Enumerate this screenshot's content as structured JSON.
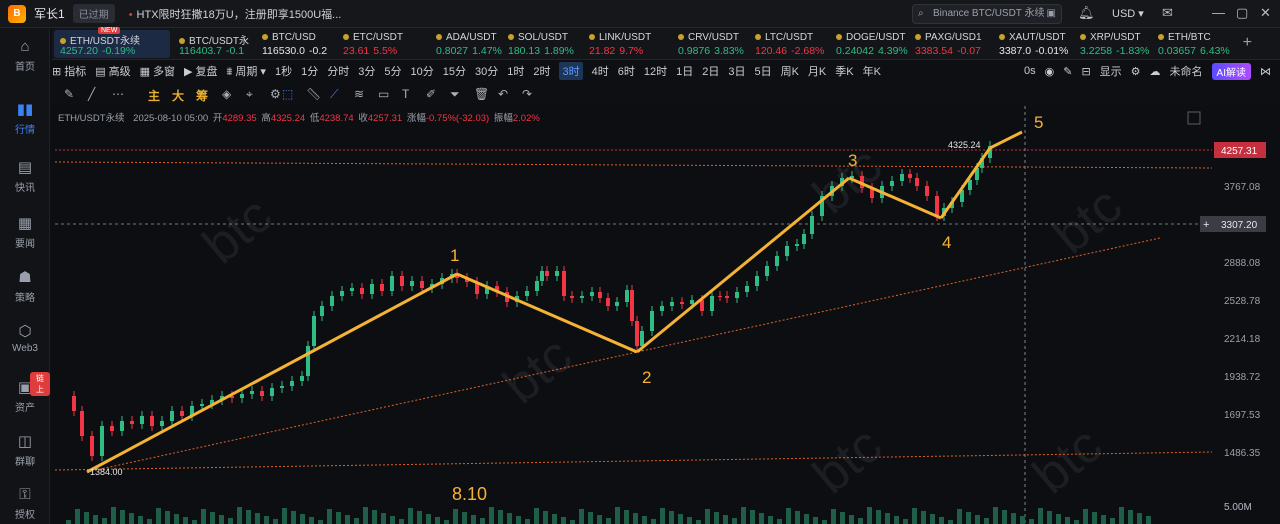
{
  "titlebar": {
    "username": "军长1",
    "status": "已过期",
    "promo": "HTX限时狂撒18万U，注册即享1500U福...",
    "search_placeholder": "Binance BTC/USDT 永续",
    "currency": "USD"
  },
  "sidebar": {
    "items": [
      {
        "label": "首页",
        "icon": "home-icon"
      },
      {
        "label": "行情",
        "icon": "chart-bars-icon"
      },
      {
        "label": "快讯",
        "icon": "news-icon"
      },
      {
        "label": "要闻",
        "icon": "document-icon"
      },
      {
        "label": "策略",
        "icon": "strategy-icon"
      },
      {
        "label": "Web3",
        "icon": "web3-icon"
      },
      {
        "label": "资产",
        "icon": "wallet-icon"
      },
      {
        "label": "群聊",
        "icon": "chat-icon"
      },
      {
        "label": "授权",
        "icon": "key-icon"
      }
    ],
    "badge": "链上"
  },
  "tickers": [
    {
      "name": "ETH/USDT永续",
      "price": "4257.20",
      "change": "-0.19%",
      "dir": "up"
    },
    {
      "name": "BTC/USDT永",
      "price": "116403.7",
      "change": "-0.1",
      "dir": "up"
    },
    {
      "name": "BTC/USD",
      "price": "116530.0",
      "change": "-0.2",
      "dir": "white"
    },
    {
      "name": "ETC/USDT",
      "price": "23.61",
      "change": "5.5%",
      "dir": "dn"
    },
    {
      "name": "ADA/USDT",
      "price": "0.8027",
      "change": "1.47%",
      "dir": "up"
    },
    {
      "name": "SOL/USDT",
      "price": "180.13",
      "change": "1.89%",
      "dir": "up"
    },
    {
      "name": "LINK/USDT",
      "price": "21.82",
      "change": "9.7%",
      "dir": "dn"
    },
    {
      "name": "CRV/USDT",
      "price": "0.9876",
      "change": "3.83%",
      "dir": "up"
    },
    {
      "name": "LTC/USDT",
      "price": "120.46",
      "change": "-2.68%",
      "dir": "dn"
    },
    {
      "name": "DOGE/USDT",
      "price": "0.24042",
      "change": "4.39%",
      "dir": "up"
    },
    {
      "name": "PAXG/USD1",
      "price": "3383.54",
      "change": "-0.07",
      "dir": "dn"
    },
    {
      "name": "XAUT/USDT",
      "price": "3387.0",
      "change": "-0.01%",
      "dir": "white"
    },
    {
      "name": "XRP/USDT",
      "price": "3.2258",
      "change": "-1.83%",
      "dir": "up"
    },
    {
      "name": "ETH/BTC",
      "price": "0.03657",
      "change": "6.43%",
      "dir": "up"
    }
  ],
  "new_badge": "NEW",
  "toolbar1": {
    "left": [
      "指标",
      "高级",
      "多窗",
      "复盘",
      "周期"
    ],
    "timeframes": [
      "1秒",
      "1分",
      "分时",
      "3分",
      "5分",
      "10分",
      "15分",
      "30分",
      "1时",
      "2时",
      "3时",
      "4时",
      "6时",
      "12时",
      "1日",
      "2日",
      "3日",
      "5日",
      "周K",
      "月K",
      "季K",
      "年K"
    ],
    "active_timeframe": "3时",
    "right_0s": "0s",
    "display": "显示",
    "layout_name": "未命名",
    "ai_button": "AI解读"
  },
  "toolbar2": {
    "labels": [
      "主",
      "大",
      "筹"
    ]
  },
  "infobar": {
    "symbol": "ETH/USDT永续",
    "datetime": "2025-08-10 05:00",
    "open_label": "开",
    "open": "4289.35",
    "high_label": "高",
    "high": "4325.24",
    "low_label": "低",
    "low": "4238.74",
    "close_label": "收",
    "close": "4257.31",
    "chg_label": "涨幅",
    "chg": "-0.75%(-32.03)",
    "amp_label": "振幅",
    "amp": "2.02%"
  },
  "chart_data": {
    "type": "candlestick",
    "y_ticks": [
      "4257.31",
      "3767.08",
      "3307.20",
      "2888.08",
      "2528.78",
      "2214.18",
      "1938.72",
      "1697.53",
      "1486.35",
      "5.00M"
    ],
    "current_price": "4257.31",
    "crosshair_price": "3307.20",
    "high_label": "4325.24",
    "low_label": "1384.00",
    "wave_labels": [
      "1",
      "2",
      "3",
      "4",
      "5"
    ],
    "date_annotation": "8.10",
    "watermark": "btc",
    "colors": {
      "up": "#2ebd85",
      "down": "#f23645",
      "wave": "#f5b335",
      "trend": "#e0622a",
      "price_tag": "#c62f3d"
    }
  }
}
